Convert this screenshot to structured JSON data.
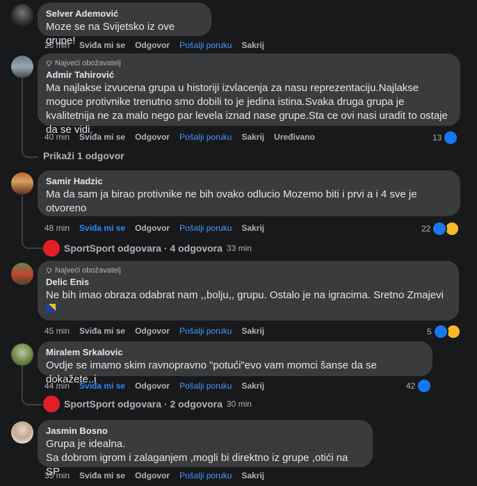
{
  "comments": [
    {
      "author": "Selver Ademović",
      "text": "Moze se na Svijetsko iz ove grupe!",
      "time": "26 min",
      "like": "Sviđa mi se",
      "reply": "Odgovor",
      "send": "Pošalji poruku",
      "hide": "Sakrij"
    },
    {
      "badge": "Najveći obožavatelj",
      "author": "Admir Tahirović",
      "text": "Ma najlakse izvucena grupa u historiji izvlacenja za nasu reprezentaciju.Najlakse moguce protivnike trenutno smo dobili to je jedina istina.Svaka druga grupa je kvalitetnija ne za malo nego par levela iznad nase grupe.Sta ce ovi nasi uradit to ostaje da se vidi.",
      "time": "40 min",
      "like": "Sviđa mi se",
      "reply": "Odgovor",
      "send": "Pošalji poruku",
      "hide": "Sakrij",
      "edited": "Uređivano",
      "reactions": "13",
      "show_replies": "Prikaži 1 odgovor"
    },
    {
      "author": "Samir Hadzic",
      "text": "Ma da sam ja birao protivnike ne bih ovako odlucio Mozemo biti i prvi a i 4 sve je otvoreno",
      "time": "48 min",
      "like": "Sviđa mi se",
      "reply": "Odgovor",
      "send": "Pošalji poruku",
      "hide": "Sakrij",
      "reactions": "22",
      "replier": "SportSport odgovara · 4 odgovora",
      "reply_time": "33 min"
    },
    {
      "badge": "Najveći obožavatelj",
      "author": "Delic Enis",
      "text": "Ne bih imao obraza odabrat nam ,,bolju,, grupu. Ostalo je na igracima. Sretno Zmajevi",
      "time": "45 min",
      "like": "Sviđa mi se",
      "reply": "Odgovor",
      "send": "Pošalji poruku",
      "hide": "Sakrij",
      "reactions": "5"
    },
    {
      "author": "Miralem Srkalovic",
      "text": "Ovdje se imamo skim ravnopravno \"potući\"evo vam momci šanse da se dokažete..i",
      "time": "44 min",
      "like": "Sviđa mi se",
      "reply": "Odgovor",
      "send": "Pošalji poruku",
      "hide": "Sakrij",
      "reactions": "42",
      "replier": "SportSport odgovara · 2 odgovora",
      "reply_time": "30 min"
    },
    {
      "author": "Jasmin Bosno",
      "text": "Grupa je idealna.\nSa dobrom igrom i zalaganjem ,mogli bi direktno iz grupe ,otići na SP",
      "time": "35 min",
      "like": "Sviđa mi se",
      "reply": "Odgovor",
      "send": "Pošalji poruku",
      "hide": "Sakrij"
    }
  ]
}
